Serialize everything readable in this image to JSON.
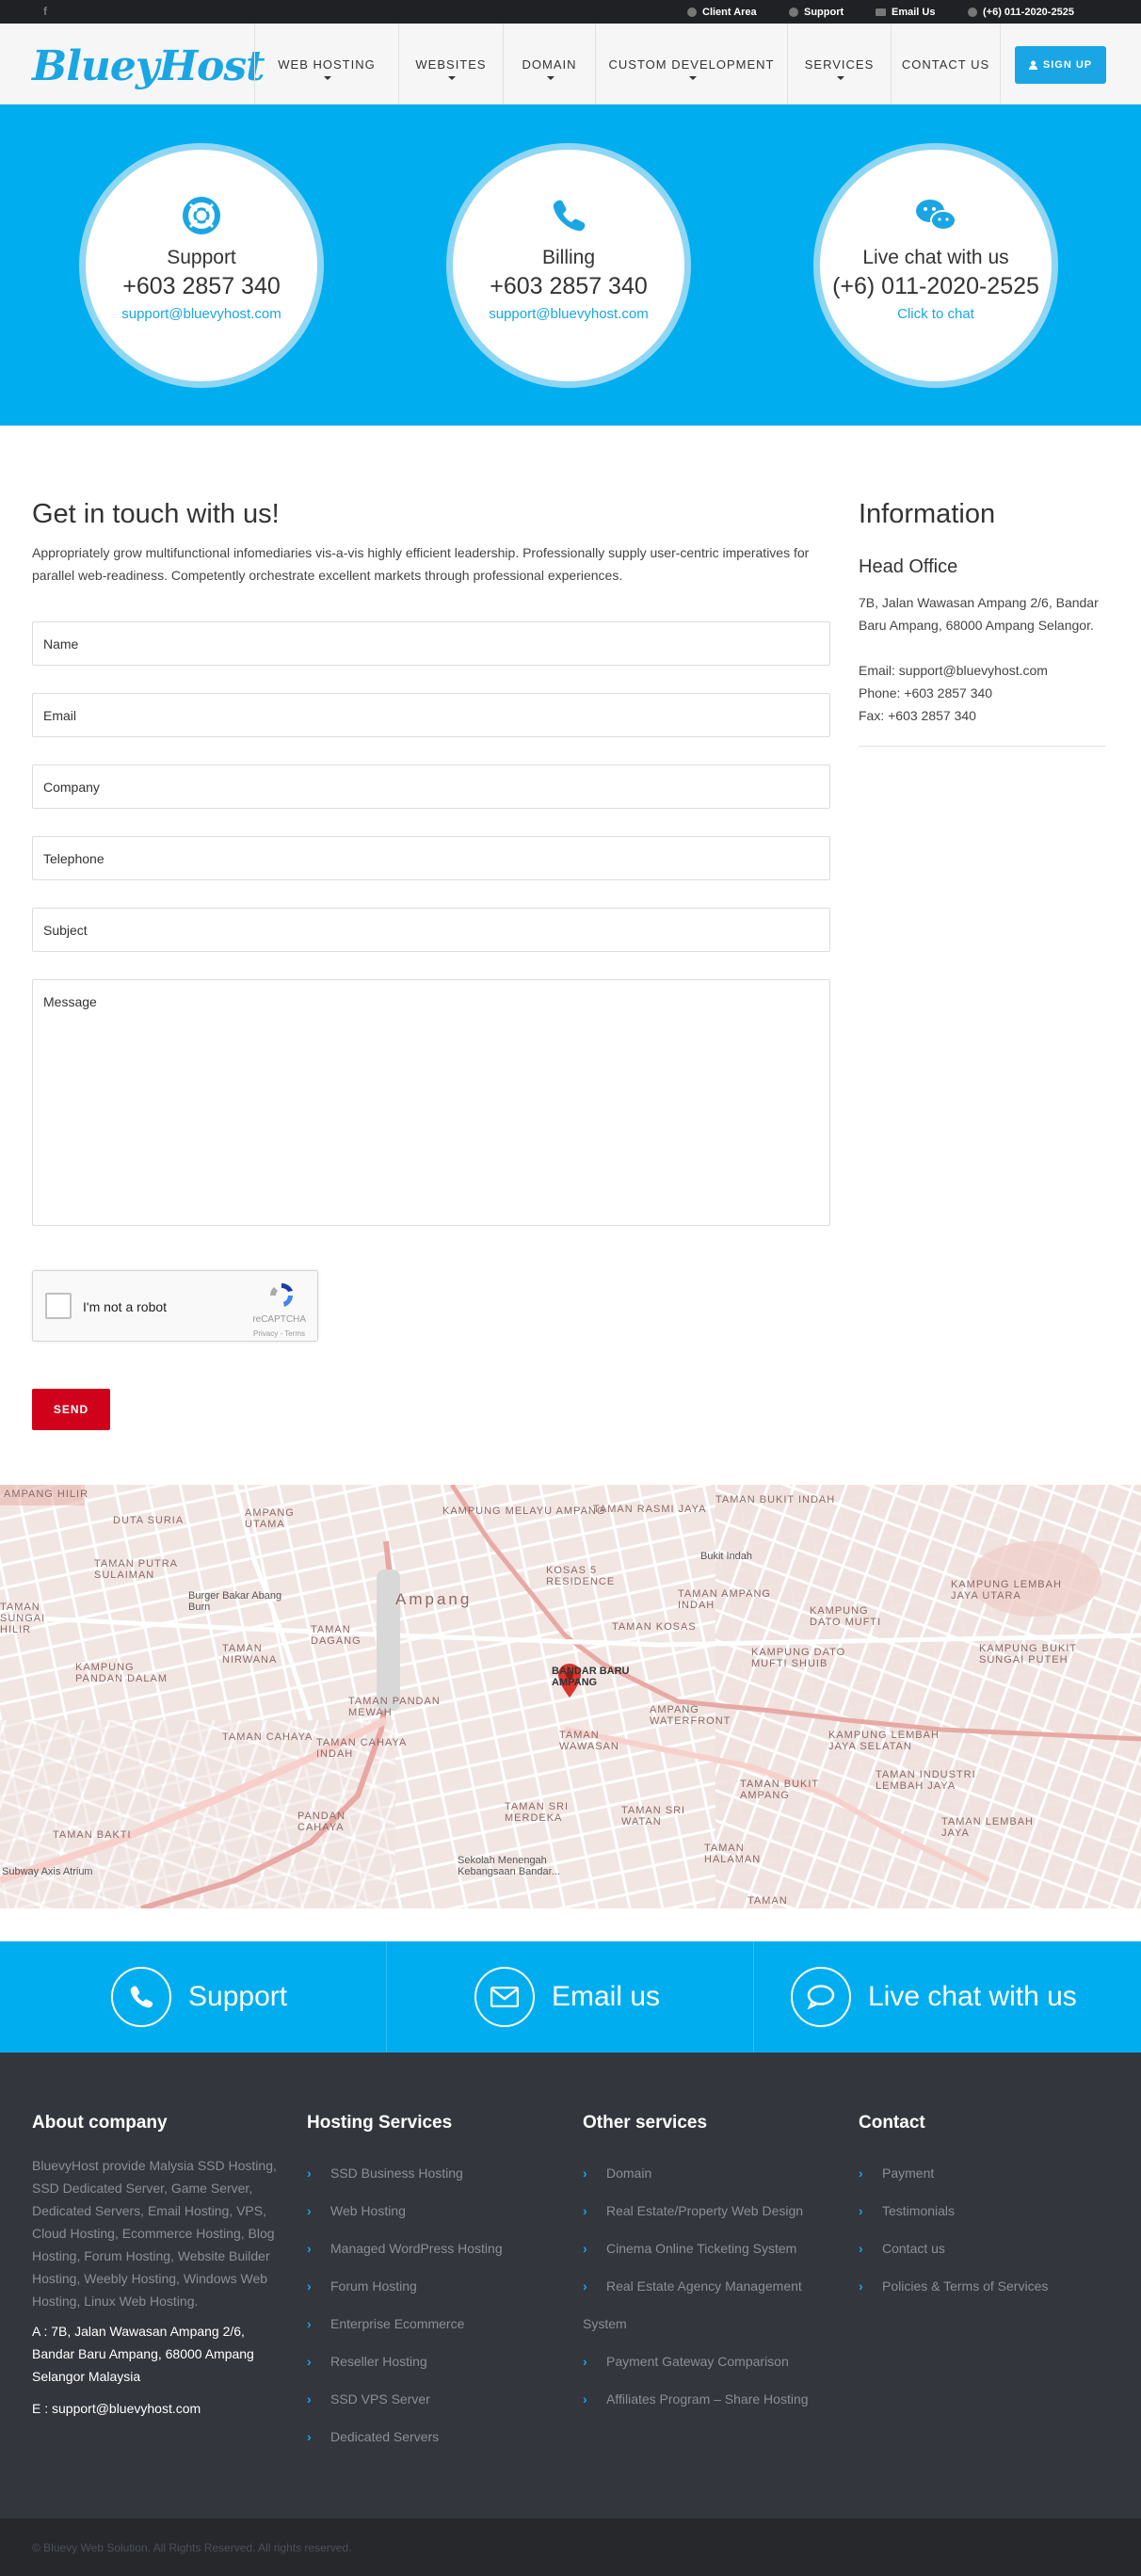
{
  "topbar": {
    "facebook": "f",
    "links": [
      {
        "label": "Client Area",
        "icon": "user-icon"
      },
      {
        "label": "Support",
        "icon": "lifebuoy-icon"
      },
      {
        "label": "Email Us",
        "icon": "envelope-icon"
      },
      {
        "label": "(+6) 011-2020-2525",
        "icon": "phone-icon"
      }
    ]
  },
  "header": {
    "logo": "BlueyHost",
    "nav": [
      "WEB HOSTING",
      "WEBSITES",
      "DOMAIN",
      "CUSTOM DEVELOPMENT",
      "SERVICES",
      "CONTACT US"
    ],
    "signup": "SIGN UP"
  },
  "hero": {
    "cards": [
      {
        "icon": "lifebuoy-icon",
        "title": "Support",
        "phone": "+603 2857 340",
        "link": "support@bluevyhost.com"
      },
      {
        "icon": "phone-icon",
        "title": "Billing",
        "phone": "+603 2857 340",
        "link": "support@bluevyhost.com"
      },
      {
        "icon": "wechat-icon",
        "title": "Live chat with us",
        "phone": "(+6) 011-2020-2525",
        "link": "Click to chat"
      }
    ]
  },
  "contact": {
    "heading": "Get in touch with us!",
    "intro": "Appropriately grow multifunctional infomediaries vis-a-vis highly efficient leadership. Professionally supply user-centric imperatives for parallel web-readiness. Competently orchestrate excellent markets through professional experiences.",
    "fields": {
      "name": "Name",
      "email": "Email",
      "company": "Company",
      "telephone": "Telephone",
      "subject": "Subject",
      "message": "Message"
    },
    "captcha": {
      "label": "I'm not a robot",
      "brand": "reCAPTCHA",
      "links": "Privacy - Terms"
    },
    "send": "SEND"
  },
  "info": {
    "heading": "Information",
    "office_title": "Head Office",
    "address": "7B, Jalan Wawasan Ampang 2/6, Bandar Baru Ampang, 68000 Ampang Selangor.",
    "email": "Email: support@bluevyhost.com",
    "phone": "Phone: +603 2857 340",
    "fax": "Fax: +603 2857 340"
  },
  "map": {
    "labels": [
      "KAMPUNG MELAYU AMPANG",
      "TAMAN RASMI JAYA",
      "TAMAN BUKIT INDAH",
      "Bukit Indah",
      "TAMAN PUTRA SULAIMAN",
      "Burger Bakar Abang Burn",
      "Ampang",
      "KOSAS 5 RESIDENCE",
      "TAMAN AMPANG INDAH",
      "KAMPUNG LEMBAH JAYA UTARA",
      "TAMAN NIRWANA",
      "TAMAN DAGANG",
      "TAMAN KOSAS",
      "KAMPUNG DATO MUFTI",
      "KAMPUNG PANDAN DALAM",
      "BANDAR BARU AMPANG",
      "KAMPUNG DATO MUFTI SHUIB",
      "KAMPUNG BUKIT SUNGAI PUTEH",
      "TAMAN PANDAN MEWAH",
      "AMPANG WATERFRONT",
      "TAMAN CAHAYA",
      "TAMAN WAWASAN",
      "KAMPUNG LEMBAH JAYA SELATAN",
      "TAMAN CAHAYA INDAH",
      "TAMAN BUKIT AMPANG",
      "TAMAN INDUSTRI LEMBAH JAYA",
      "TAMAN BAKTI",
      "PANDAN CAHAYA",
      "TAMAN SRI MERDEKA",
      "TAMAN SRI WATAN",
      "TAMAN LEMBAH JAYA",
      "Subway Axis Atrium",
      "Sekolah Menengah Kebangsaan Bandar...",
      "TAMAN HALAMAN",
      "TAMAN",
      "TAMAN SUNGAI HILIR",
      "DUTA SURIA",
      "AMPANG UTAMA",
      "AMPANG HILIR"
    ]
  },
  "strip": [
    {
      "icon": "phone-icon",
      "label": "Support"
    },
    {
      "icon": "envelope-icon",
      "label": "Email us"
    },
    {
      "icon": "chat-bubble-icon",
      "label": "Live chat with us"
    }
  ],
  "footer": {
    "about": {
      "title": "About company",
      "text": "BluevyHost provide Malysia SSD Hosting, SSD Dedicated Server, Game Server, Dedicated Servers, Email Hosting, VPS, Cloud Hosting, Ecommerce Hosting, Blog Hosting, Forum Hosting, Website Builder Hosting, Weebly Hosting, Windows Web Hosting, Linux Web Hosting.",
      "address": "A : 7B, Jalan Wawasan Ampang 2/6, Bandar Baru Ampang, 68000 Ampang Selangor Malaysia",
      "email": "E : support@bluevyhost.com"
    },
    "hosting": {
      "title": "Hosting Services",
      "items": [
        "SSD Business Hosting",
        "Web Hosting",
        "Managed WordPress Hosting",
        "Forum Hosting",
        "Enterprise Ecommerce",
        "Reseller Hosting",
        "SSD VPS Server",
        "Dedicated Servers"
      ]
    },
    "other": {
      "title": "Other services",
      "items": [
        "Domain",
        "Real Estate/Property Web Design",
        "Cinema Online Ticketing System",
        "Real Estate Agency Management",
        "System",
        "Payment Gateway Comparison",
        "Affiliates Program – Share Hosting"
      ]
    },
    "contact": {
      "title": "Contact",
      "items": [
        "Payment",
        "Testimonials",
        "Contact us",
        "Policies & Terms of Services"
      ]
    },
    "copyright": "© Bluevy Web Solution. All Rights Reserved. All rights reserved."
  },
  "colors": {
    "brand": "#1aa6e4",
    "hero": "#00aeef",
    "send": "#d0021b",
    "footer": "#33363d"
  }
}
